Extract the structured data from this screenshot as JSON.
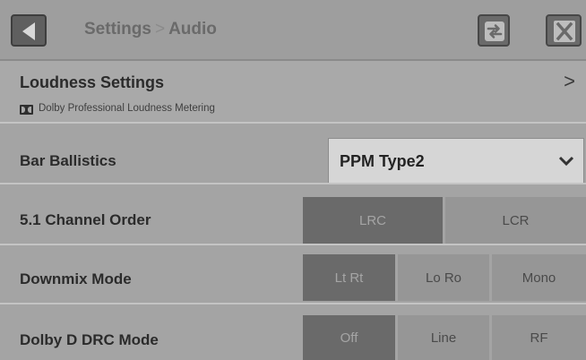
{
  "header": {
    "breadcrumb_parent": "Settings",
    "breadcrumb_separator": ">",
    "breadcrumb_current": "Audio",
    "back_icon": "back-arrow-icon",
    "swap_icon": "swap-arrows-icon",
    "close_icon": "close-icon"
  },
  "loudness": {
    "title": "Loudness Settings",
    "chevron": ">",
    "subtitle": "Dolby Professional Loudness Metering",
    "logo_icon": "dolby-logo-icon"
  },
  "bar_ballistics": {
    "label": "Bar Ballistics",
    "value": "PPM Type2"
  },
  "channel_order": {
    "label": "5.1 Channel Order",
    "options": [
      "LRC",
      "LCR"
    ],
    "selected": "LRC"
  },
  "downmix": {
    "label": "Downmix Mode",
    "options": [
      "Lt Rt",
      "Lo Ro",
      "Mono"
    ],
    "selected": "Lt Rt"
  },
  "drc": {
    "label": "Dolby D DRC Mode",
    "options": [
      "Off",
      "Line",
      "RF"
    ],
    "selected": "Off"
  },
  "colors": {
    "background": "#a8a8a8",
    "active_segment": "#6a6a6a",
    "inactive_segment": "#969696",
    "select_bg": "#d6d6d6"
  }
}
